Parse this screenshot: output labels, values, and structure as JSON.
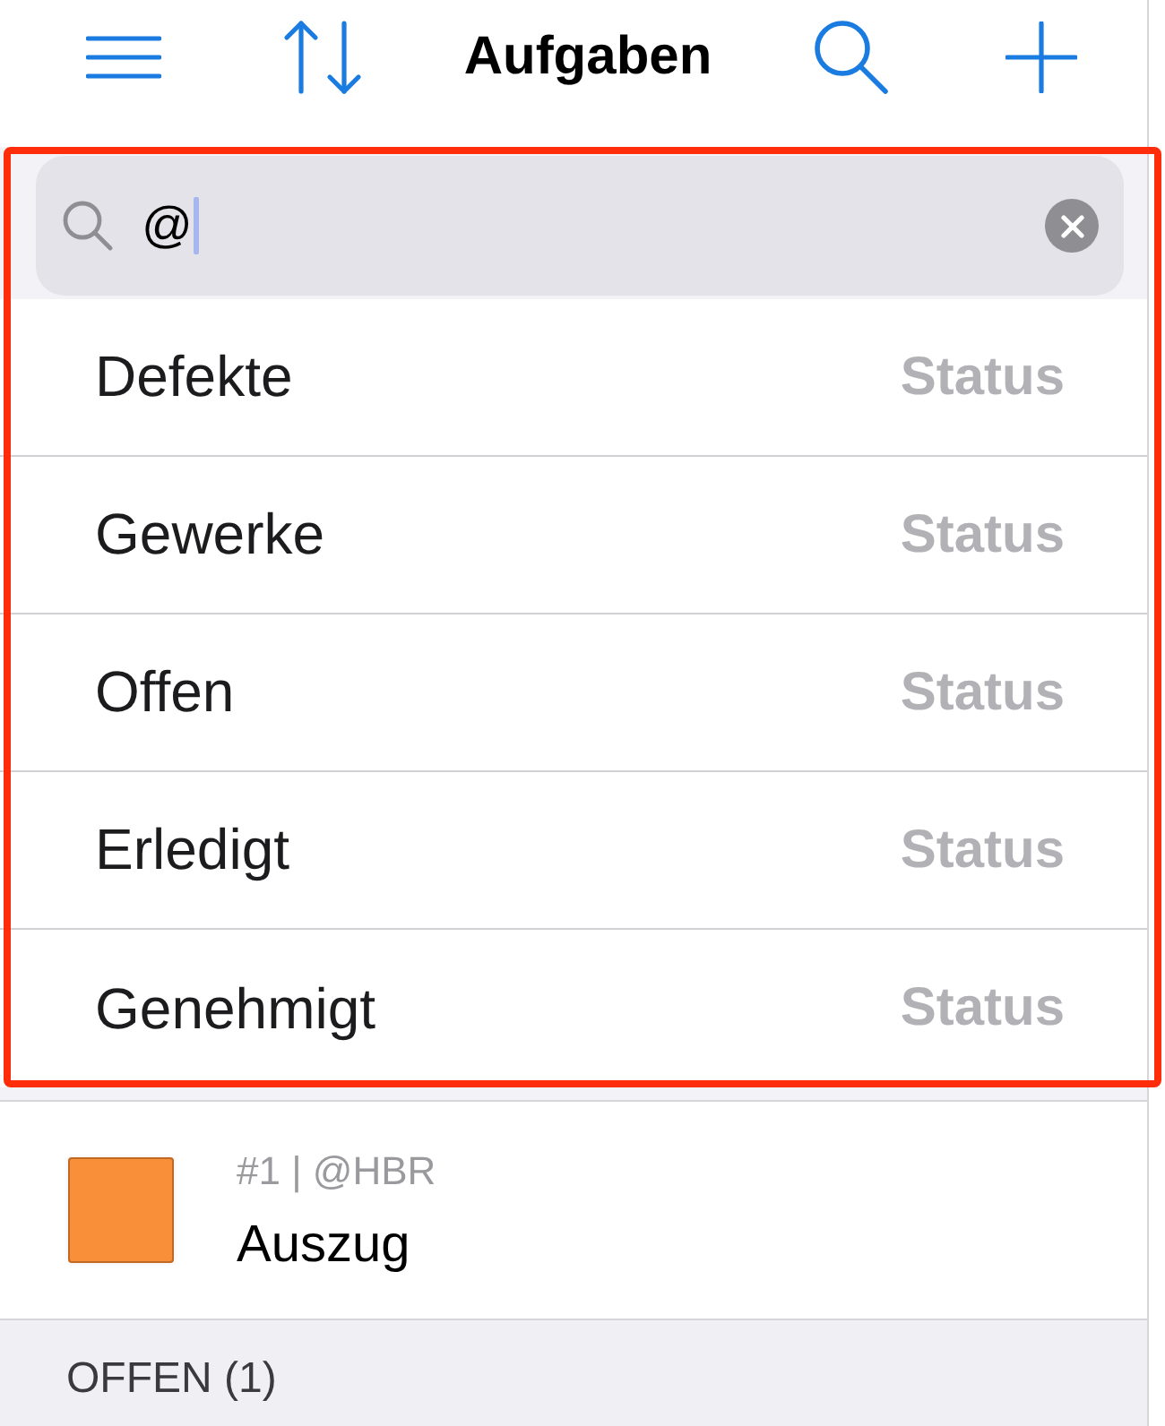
{
  "nav_bar": {
    "title": "Aufgaben"
  },
  "search": {
    "value": "@"
  },
  "suggestions": [
    {
      "label": "Defekte",
      "category": "Status"
    },
    {
      "label": "Gewerke",
      "category": "Status"
    },
    {
      "label": "Offen",
      "category": "Status"
    },
    {
      "label": "Erledigt",
      "category": "Status"
    },
    {
      "label": "Genehmigt",
      "category": "Status"
    }
  ],
  "tasks": [
    {
      "meta": "#1 | @HBR",
      "title": "Auszug",
      "color": "#f98f39"
    }
  ],
  "sections": [
    {
      "label": "OFFEN (1)"
    }
  ]
}
